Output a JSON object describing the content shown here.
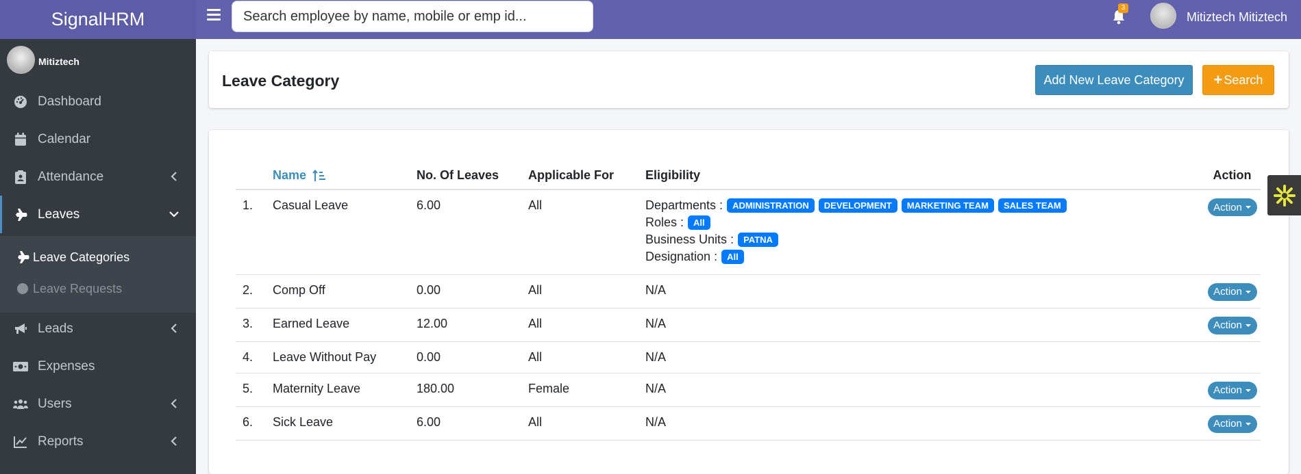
{
  "app": {
    "brand": "SignalHRM"
  },
  "topbar": {
    "search_placeholder": "Search employee by name, mobile or emp id...",
    "notification_count": "3",
    "user_name": "Mitiztech Mitiztech"
  },
  "sidebar": {
    "user_name": "Mitiztech",
    "items": [
      {
        "label": "Dashboard"
      },
      {
        "label": "Calendar"
      },
      {
        "label": "Attendance"
      },
      {
        "label": "Leaves"
      },
      {
        "label": "Leads"
      },
      {
        "label": "Expenses"
      },
      {
        "label": "Users"
      },
      {
        "label": "Reports"
      }
    ],
    "sub_items": [
      {
        "label": "Leave Categories"
      },
      {
        "label": "Leave Requests"
      }
    ]
  },
  "page": {
    "title": "Leave Category",
    "add_button": "Add New Leave Category",
    "search_button": "Search"
  },
  "table": {
    "headers": [
      "Name",
      "No. Of Leaves",
      "Applicable For",
      "Eligibility",
      "Action"
    ],
    "action_label": "Action",
    "rows": [
      {
        "num": "1.",
        "name": "Casual Leave",
        "leaves": "6.00",
        "applicable": "All",
        "eligibility": {
          "departments_label": "Departments :",
          "departments": [
            "ADMINISTRATION",
            "DEVELOPMENT",
            "MARKETING TEAM",
            "SALES TEAM"
          ],
          "roles_label": "Roles :",
          "roles": [
            "All"
          ],
          "business_units_label": "Business Units :",
          "business_units": [
            "PATNA"
          ],
          "designation_label": "Designation :",
          "designation": [
            "All"
          ]
        },
        "has_action": true
      },
      {
        "num": "2.",
        "name": "Comp Off",
        "leaves": "0.00",
        "applicable": "All",
        "eligibility_text": "N/A",
        "has_action": true
      },
      {
        "num": "3.",
        "name": "Earned Leave",
        "leaves": "12.00",
        "applicable": "All",
        "eligibility_text": "N/A",
        "has_action": true
      },
      {
        "num": "4.",
        "name": "Leave Without Pay",
        "leaves": "0.00",
        "applicable": "All",
        "eligibility_text": "N/A",
        "has_action": false
      },
      {
        "num": "5.",
        "name": "Maternity Leave",
        "leaves": "180.00",
        "applicable": "Female",
        "eligibility_text": "N/A",
        "has_action": true
      },
      {
        "num": "6.",
        "name": "Sick Leave",
        "leaves": "6.00",
        "applicable": "All",
        "eligibility_text": "N/A",
        "has_action": true
      }
    ]
  },
  "colors": {
    "topbar": "#6261ad",
    "sidebar": "#343a40",
    "primary": "#3c8dbc",
    "warning": "#f39c12",
    "badge": "#007bff"
  }
}
